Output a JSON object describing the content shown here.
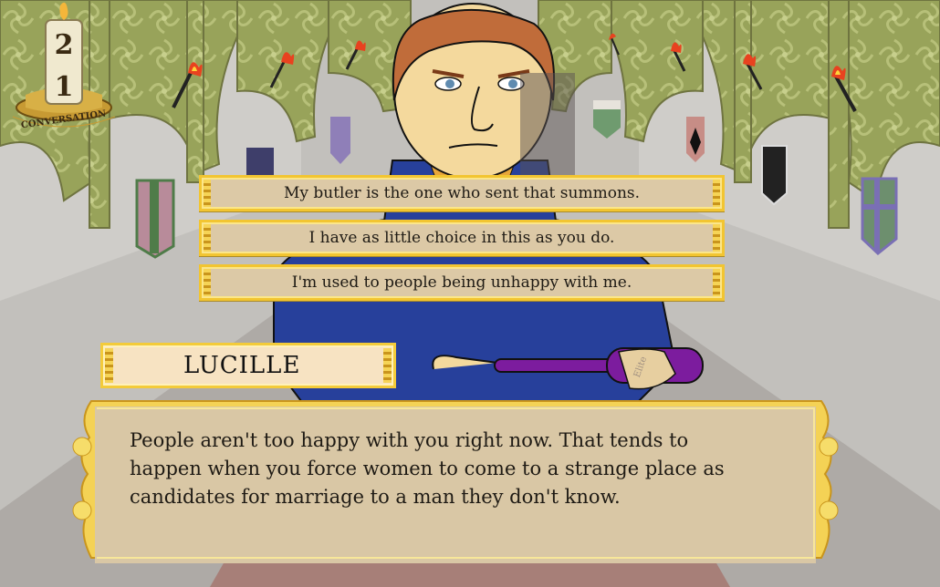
{
  "hud": {
    "counter_top": "2",
    "counter_bottom": "1",
    "counter_label": "CONVERSATION"
  },
  "choices": [
    {
      "label": "My butler is the one who sent that summons."
    },
    {
      "label": "I have as little choice in this as you do."
    },
    {
      "label": "I'm used to people being unhappy with me."
    }
  ],
  "dialog": {
    "speaker": "LUCILLE",
    "text": "People aren't too happy with you right now. That tends to happen when you force women to come to a strange place as candidates for marriage to a man they don't know."
  },
  "props": {
    "bottle_label": "Elite"
  }
}
